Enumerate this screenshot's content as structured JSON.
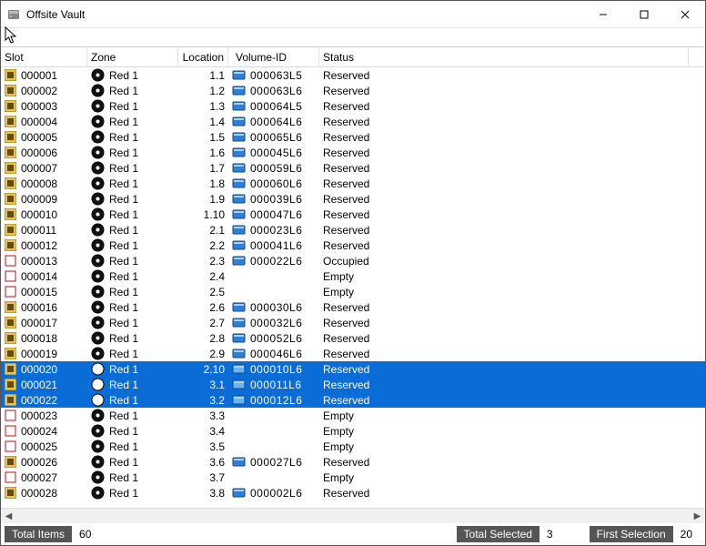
{
  "window": {
    "title": "Offsite Vault"
  },
  "columns": {
    "slot": "Slot",
    "zone": "Zone",
    "loc": "Location",
    "vol": "Volume-ID",
    "status": "Status"
  },
  "statusbar": {
    "total_items_label": "Total Items",
    "total_items_value": "60",
    "total_selected_label": "Total Selected",
    "total_selected_value": "3",
    "first_selection_label": "First Selection",
    "first_selection_value": "20"
  },
  "rows": [
    {
      "slot": "000001",
      "slotState": "full",
      "zone": "Red 1",
      "loc": "1.1",
      "vol": "000063L5",
      "status": "Reserved",
      "selected": false
    },
    {
      "slot": "000002",
      "slotState": "full",
      "zone": "Red 1",
      "loc": "1.2",
      "vol": "000063L6",
      "status": "Reserved",
      "selected": false
    },
    {
      "slot": "000003",
      "slotState": "full",
      "zone": "Red 1",
      "loc": "1.3",
      "vol": "000064L5",
      "status": "Reserved",
      "selected": false
    },
    {
      "slot": "000004",
      "slotState": "full",
      "zone": "Red 1",
      "loc": "1.4",
      "vol": "000064L6",
      "status": "Reserved",
      "selected": false
    },
    {
      "slot": "000005",
      "slotState": "full",
      "zone": "Red 1",
      "loc": "1.5",
      "vol": "000065L6",
      "status": "Reserved",
      "selected": false
    },
    {
      "slot": "000006",
      "slotState": "full",
      "zone": "Red 1",
      "loc": "1.6",
      "vol": "000045L6",
      "status": "Reserved",
      "selected": false
    },
    {
      "slot": "000007",
      "slotState": "full",
      "zone": "Red 1",
      "loc": "1.7",
      "vol": "000059L6",
      "status": "Reserved",
      "selected": false
    },
    {
      "slot": "000008",
      "slotState": "full",
      "zone": "Red 1",
      "loc": "1.8",
      "vol": "000060L6",
      "status": "Reserved",
      "selected": false
    },
    {
      "slot": "000009",
      "slotState": "full",
      "zone": "Red 1",
      "loc": "1.9",
      "vol": "000039L6",
      "status": "Reserved",
      "selected": false
    },
    {
      "slot": "000010",
      "slotState": "full",
      "zone": "Red 1",
      "loc": "1.10",
      "vol": "000047L6",
      "status": "Reserved",
      "selected": false
    },
    {
      "slot": "000011",
      "slotState": "full",
      "zone": "Red 1",
      "loc": "2.1",
      "vol": "000023L6",
      "status": "Reserved",
      "selected": false
    },
    {
      "slot": "000012",
      "slotState": "full",
      "zone": "Red 1",
      "loc": "2.2",
      "vol": "000041L6",
      "status": "Reserved",
      "selected": false
    },
    {
      "slot": "000013",
      "slotState": "empty",
      "zone": "Red 1",
      "loc": "2.3",
      "vol": "000022L6",
      "status": "Occupied",
      "selected": false
    },
    {
      "slot": "000014",
      "slotState": "empty",
      "zone": "Red 1",
      "loc": "2.4",
      "vol": "",
      "status": "Empty",
      "selected": false
    },
    {
      "slot": "000015",
      "slotState": "empty",
      "zone": "Red 1",
      "loc": "2.5",
      "vol": "",
      "status": "Empty",
      "selected": false
    },
    {
      "slot": "000016",
      "slotState": "full",
      "zone": "Red 1",
      "loc": "2.6",
      "vol": "000030L6",
      "status": "Reserved",
      "selected": false
    },
    {
      "slot": "000017",
      "slotState": "full",
      "zone": "Red 1",
      "loc": "2.7",
      "vol": "000032L6",
      "status": "Reserved",
      "selected": false
    },
    {
      "slot": "000018",
      "slotState": "full",
      "zone": "Red 1",
      "loc": "2.8",
      "vol": "000052L6",
      "status": "Reserved",
      "selected": false
    },
    {
      "slot": "000019",
      "slotState": "full",
      "zone": "Red 1",
      "loc": "2.9",
      "vol": "000046L6",
      "status": "Reserved",
      "selected": false
    },
    {
      "slot": "000020",
      "slotState": "full",
      "zone": "Red 1",
      "loc": "2.10",
      "vol": "000010L6",
      "status": "Reserved",
      "selected": true
    },
    {
      "slot": "000021",
      "slotState": "full",
      "zone": "Red 1",
      "loc": "3.1",
      "vol": "000011L6",
      "status": "Reserved",
      "selected": true
    },
    {
      "slot": "000022",
      "slotState": "full",
      "zone": "Red 1",
      "loc": "3.2",
      "vol": "000012L6",
      "status": "Reserved",
      "selected": true
    },
    {
      "slot": "000023",
      "slotState": "empty",
      "zone": "Red 1",
      "loc": "3.3",
      "vol": "",
      "status": "Empty",
      "selected": false
    },
    {
      "slot": "000024",
      "slotState": "empty",
      "zone": "Red 1",
      "loc": "3.4",
      "vol": "",
      "status": "Empty",
      "selected": false
    },
    {
      "slot": "000025",
      "slotState": "empty",
      "zone": "Red 1",
      "loc": "3.5",
      "vol": "",
      "status": "Empty",
      "selected": false
    },
    {
      "slot": "000026",
      "slotState": "full",
      "zone": "Red 1",
      "loc": "3.6",
      "vol": "000027L6",
      "status": "Reserved",
      "selected": false
    },
    {
      "slot": "000027",
      "slotState": "empty",
      "zone": "Red 1",
      "loc": "3.7",
      "vol": "",
      "status": "Empty",
      "selected": false
    },
    {
      "slot": "000028",
      "slotState": "full",
      "zone": "Red 1",
      "loc": "3.8",
      "vol": "000002L6",
      "status": "Reserved",
      "selected": false
    }
  ]
}
